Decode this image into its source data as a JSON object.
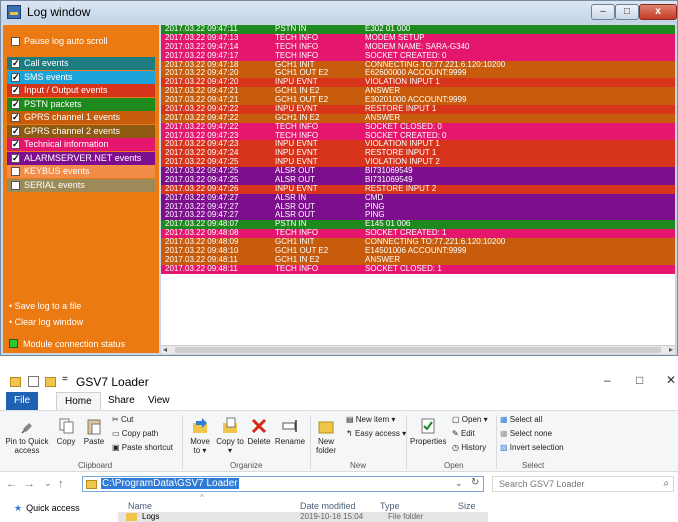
{
  "log_window": {
    "title": "Log window",
    "controls": {
      "minimize": "–",
      "maximize": "□",
      "close": "x"
    },
    "sidebar": {
      "pause_label": "Pause log auto scroll",
      "pause_checked": false,
      "categories": [
        {
          "label": "Call events",
          "checked": true,
          "color": "#1c7c80"
        },
        {
          "label": "SMS events",
          "checked": true,
          "color": "#1da3d8"
        },
        {
          "label": "Input / Output events",
          "checked": true,
          "color": "#d8341c"
        },
        {
          "label": "PSTN packets",
          "checked": true,
          "color": "#1e8a1e"
        },
        {
          "label": "GPRS channel 1 events",
          "checked": true,
          "color": "#c65c0c"
        },
        {
          "label": "GPRS channel 2 events",
          "checked": true,
          "color": "#8f5b12"
        },
        {
          "label": "Technical information",
          "checked": true,
          "color": "#e5166d"
        },
        {
          "label": "ALARMSERVER.NET events",
          "checked": true,
          "color": "#7d0f8f"
        },
        {
          "label": "KEYBUS events",
          "checked": false,
          "color": "#f28c48"
        },
        {
          "label": "SERIAL events",
          "checked": false,
          "color": "#9c8a58"
        }
      ],
      "save_link": "• Save log to a file",
      "clear_link": "• Clear log window",
      "status_label": "Module connection status"
    },
    "rows": [
      {
        "time": "2017.03.22 09:47:11",
        "type": "PSTN IN",
        "message": "E302 01 000",
        "color": "#1e8a1e"
      },
      {
        "time": "2017.03.22 09:47:13",
        "type": "TECH INFO",
        "message": "MODEM SETUP",
        "color": "#e5166d"
      },
      {
        "time": "2017.03.22 09:47:14",
        "type": "TECH INFO",
        "message": "MODEM NAME: SARA-G340",
        "color": "#e5166d"
      },
      {
        "time": "2017.03.22 09:47:17",
        "type": "TECH INFO",
        "message": "SOCKET CREATED: 0",
        "color": "#e5166d"
      },
      {
        "time": "2017.03.22 09:47:18",
        "type": "GCH1 INIT",
        "message": "CONNECTING TO:77.221.6.120:10200",
        "color": "#c65c0c"
      },
      {
        "time": "2017.03.22 09:47:20",
        "type": "GCH1 OUT E2",
        "message": "E62600000 ACCOUNT:9999",
        "color": "#c65c0c"
      },
      {
        "time": "2017.03.22 09:47:20",
        "type": "INPU EVNT",
        "message": "VIOLATION INPUT 1",
        "color": "#d8341c"
      },
      {
        "time": "2017.03.22 09:47:21",
        "type": "GCH1 IN E2",
        "message": "ANSWER",
        "color": "#c65c0c"
      },
      {
        "time": "2017.03.22 09:47:21",
        "type": "GCH1 OUT E2",
        "message": "E30201000 ACCOUNT:9999",
        "color": "#c65c0c"
      },
      {
        "time": "2017.03.22 09:47:22",
        "type": "INPU EVNT",
        "message": "RESTORE INPUT 1",
        "color": "#d8341c"
      },
      {
        "time": "2017.03.22 09:47:22",
        "type": "GCH1 IN E2",
        "message": "ANSWER",
        "color": "#c65c0c"
      },
      {
        "time": "2017.03.22 09:47:22",
        "type": "TECH INFO",
        "message": "SOCKET CLOSED: 0",
        "color": "#e5166d"
      },
      {
        "time": "2017.03.22 09:47:23",
        "type": "TECH INFO",
        "message": "SOCKET CREATED: 0",
        "color": "#e5166d"
      },
      {
        "time": "2017.03.22 09:47:23",
        "type": "INPU EVNT",
        "message": "VIOLATION INPUT 1",
        "color": "#d8341c"
      },
      {
        "time": "2017.03.22 09:47:24",
        "type": "INPU EVNT",
        "message": "RESTORE INPUT 1",
        "color": "#d8341c"
      },
      {
        "time": "2017.03.22 09:47:25",
        "type": "INPU EVNT",
        "message": "VIOLATION INPUT 2",
        "color": "#d8341c"
      },
      {
        "time": "2017.03.22 09:47:25",
        "type": "ALSR OUT",
        "message": "BI731069549",
        "color": "#7d0f8f"
      },
      {
        "time": "2017.03.22 09:47:25",
        "type": "ALSR OUT",
        "message": "BI731069549",
        "color": "#7d0f8f"
      },
      {
        "time": "2017.03.22 09:47:26",
        "type": "INPU EVNT",
        "message": "RESTORE INPUT 2",
        "color": "#d8341c"
      },
      {
        "time": "2017.03.22 09:47:27",
        "type": "ALSR IN",
        "message": "CMD",
        "color": "#7d0f8f"
      },
      {
        "time": "2017.03.22 09:47:27",
        "type": "ALSR OUT",
        "message": "PING",
        "color": "#7d0f8f"
      },
      {
        "time": "2017.03.22 09:47:27",
        "type": "ALSR OUT",
        "message": "PING",
        "color": "#7d0f8f"
      },
      {
        "time": "2017.03.22 09:48:07",
        "type": "PSTN IN",
        "message": "E145 01 006",
        "color": "#1e8a1e"
      },
      {
        "time": "2017.03.22 09:48:08",
        "type": "TECH INFO",
        "message": "SOCKET CREATED: 1",
        "color": "#e5166d"
      },
      {
        "time": "2017.03.22 09:48:09",
        "type": "GCH1 INIT",
        "message": "CONNECTING TO:77.221.6.120:10200",
        "color": "#c65c0c"
      },
      {
        "time": "2017.03.22 09:48:10",
        "type": "GCH1 OUT E2",
        "message": "E14501006 ACCOUNT:9999",
        "color": "#c65c0c"
      },
      {
        "time": "2017.03.22 09:48:11",
        "type": "GCH1 IN E2",
        "message": "ANSWER",
        "color": "#c65c0c"
      },
      {
        "time": "2017.03.22 09:48:11",
        "type": "TECH INFO",
        "message": "SOCKET CLOSED: 1",
        "color": "#e5166d"
      }
    ],
    "scrollbar": {
      "left_arrow": "◂",
      "right_arrow": "▸",
      "thumb_grip": "III"
    }
  },
  "explorer": {
    "title": "GSV7 Loader",
    "title_prefix": "=",
    "controls": {
      "minimize": "–",
      "maximize": "□",
      "close": "✕"
    },
    "tabs": [
      "File",
      "Home",
      "Share",
      "View"
    ],
    "ribbon": {
      "clipboard": {
        "pin": "Pin to Quick access",
        "copy": "Copy",
        "paste": "Paste",
        "cut": "Cut",
        "copy_path": "Copy path",
        "paste_shortcut": "Paste shortcut",
        "group": "Clipboard"
      },
      "organize": {
        "move_to": "Move to ▾",
        "copy_to": "Copy to ▾",
        "delete": "Delete",
        "rename": "Rename",
        "group": "Organize"
      },
      "new": {
        "new_folder": "New folder",
        "new_item": "New item ▾",
        "easy_access": "Easy access ▾",
        "group": "New"
      },
      "open": {
        "properties": "Properties",
        "open": "Open ▾",
        "edit": "Edit",
        "history": "History",
        "group": "Open"
      },
      "select": {
        "select_all": "Select all",
        "select_none": "Select none",
        "invert": "Invert selection",
        "group": "Select"
      }
    },
    "address": {
      "back": "←",
      "forward": "→",
      "dropdown": "⌄",
      "up": "↑",
      "path": "C:\\ProgramData\\GSV7 Loader",
      "search_placeholder": "Search GSV7 Loader",
      "search_icon": "⌕",
      "refresh": "↻",
      "path_dropdown": "⌄"
    },
    "nav": {
      "quick_access": "Quick access"
    },
    "columns": {
      "name": "Name",
      "date": "Date modified",
      "type": "Type",
      "size": "Size",
      "sort_arrow": "^"
    },
    "files": [
      {
        "name": "Logs",
        "date": "2019-10-16 15:04",
        "type": "File folder"
      }
    ]
  }
}
